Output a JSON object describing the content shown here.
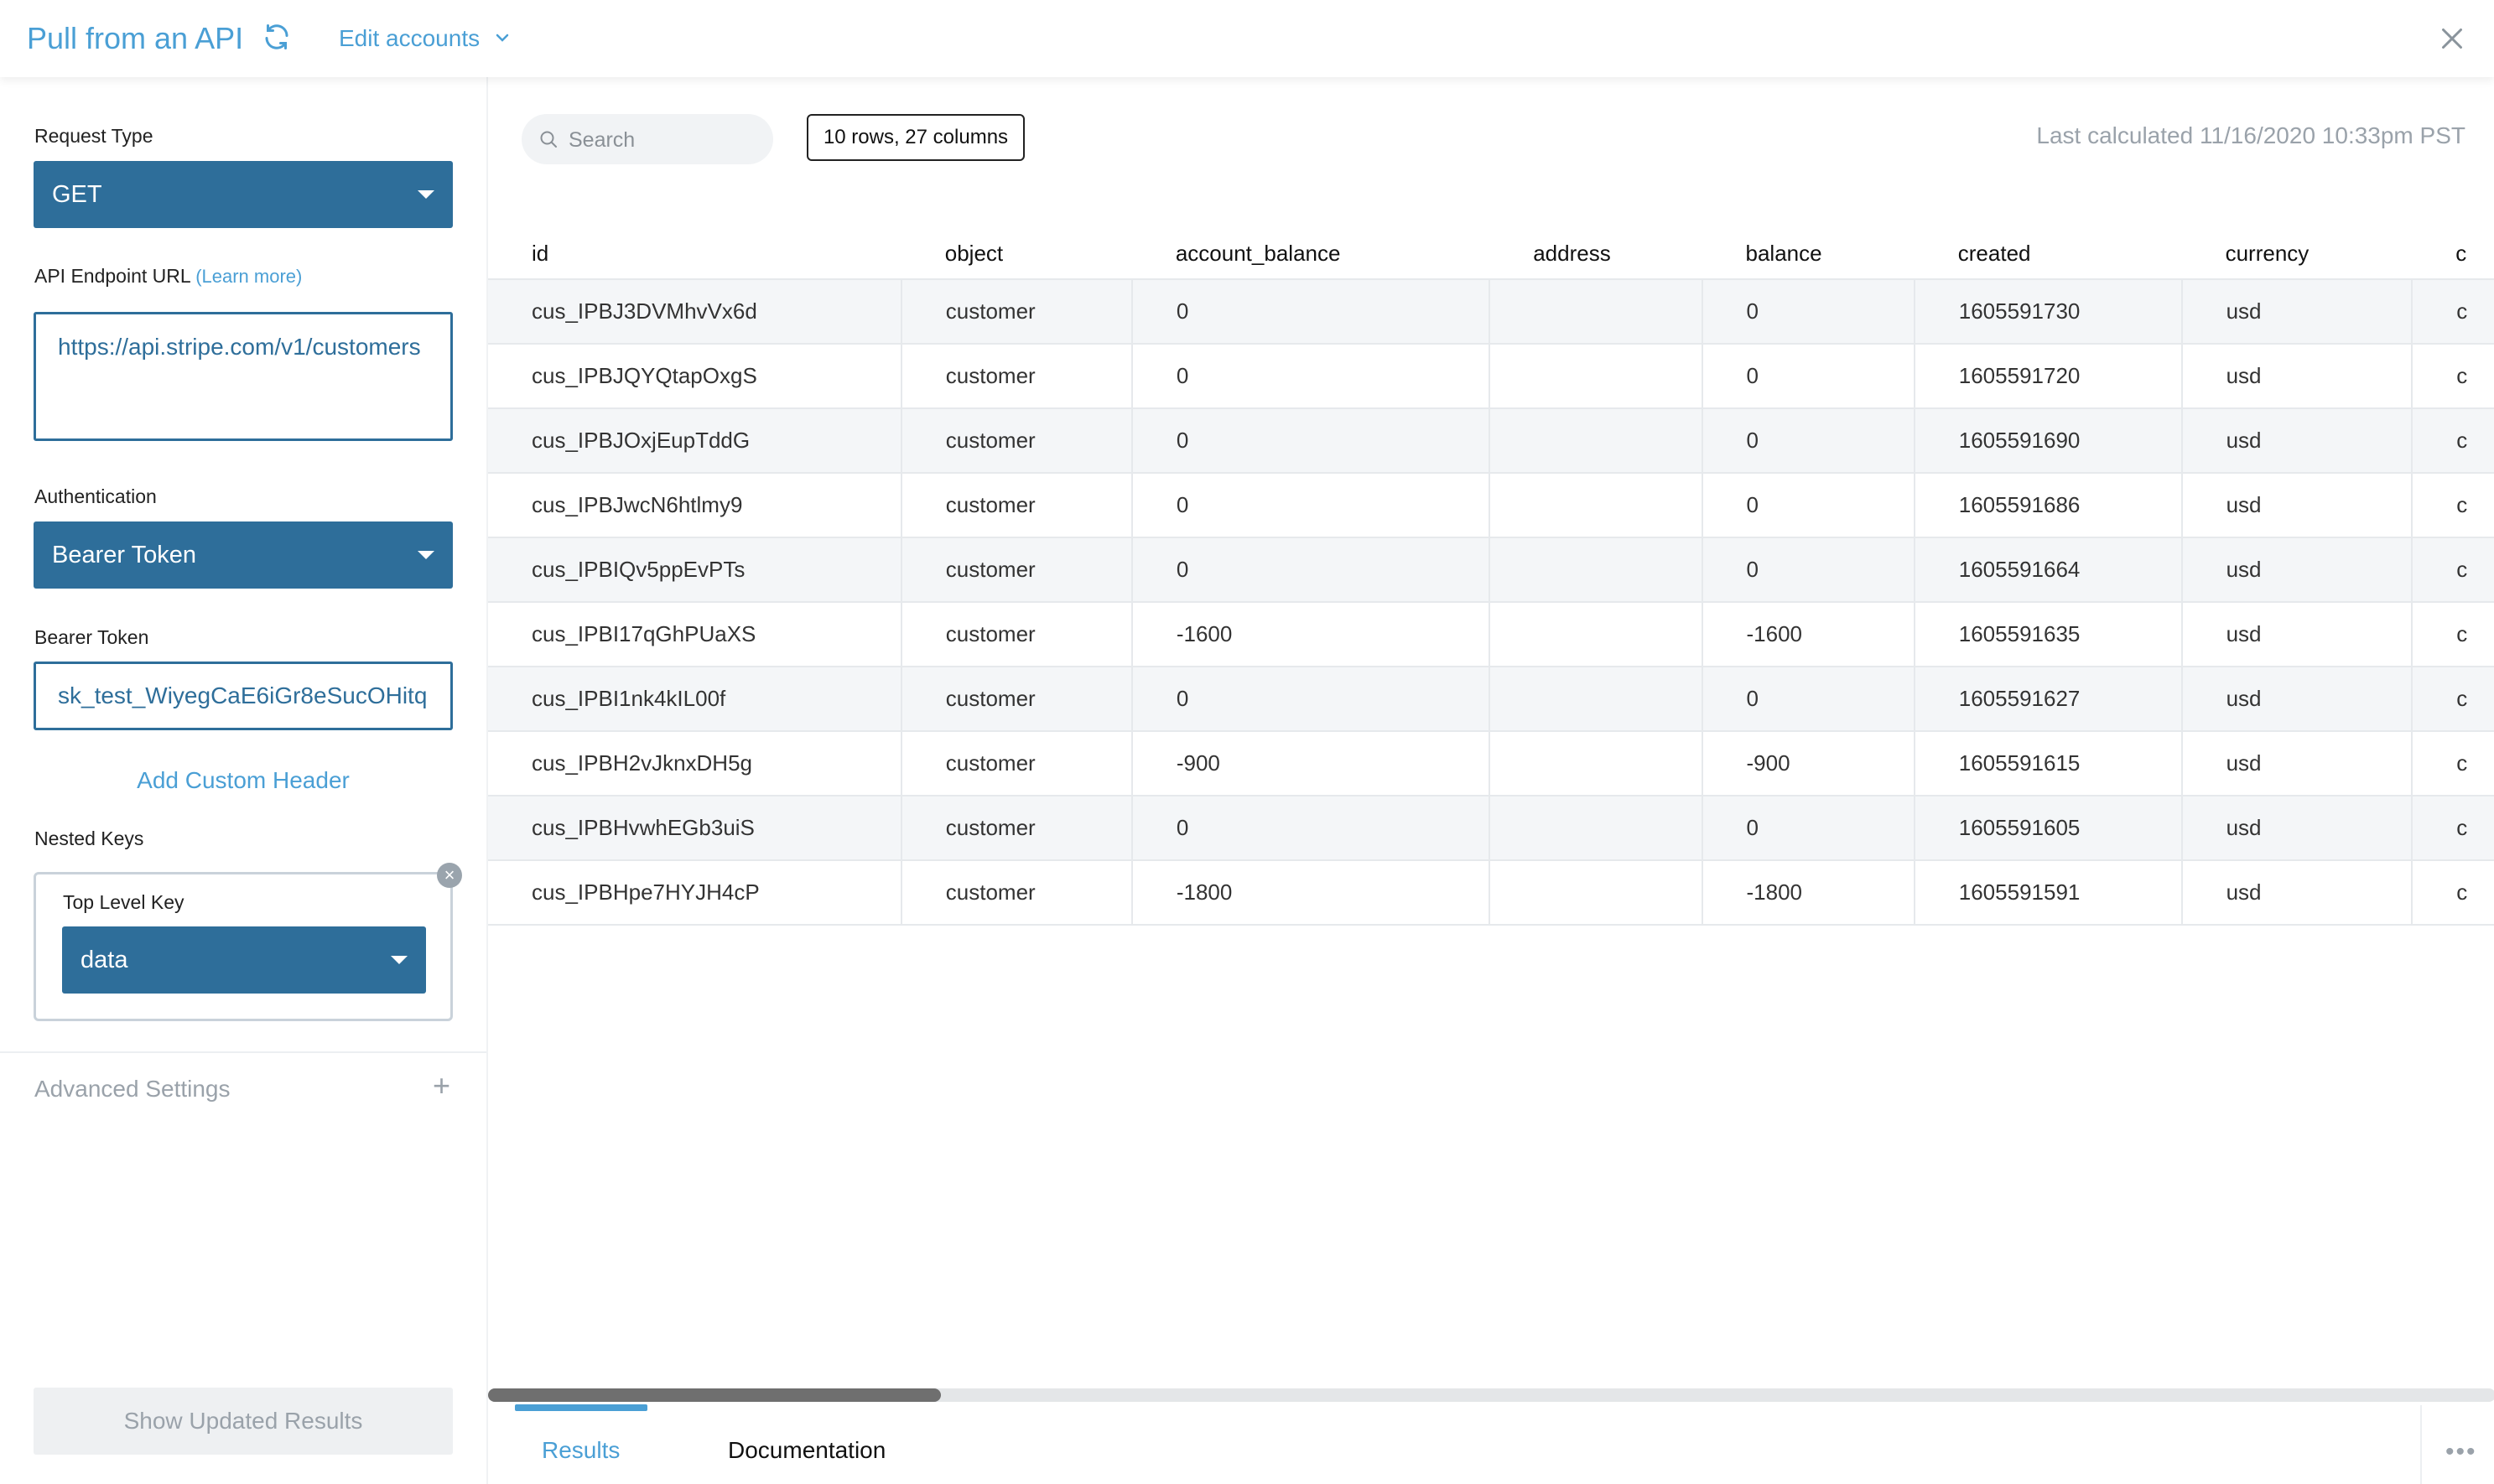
{
  "header": {
    "title": "Pull from an API",
    "edit_accounts": "Edit accounts"
  },
  "left": {
    "request_type_label": "Request Type",
    "request_type_value": "GET",
    "endpoint_label": "API Endpoint URL",
    "learn_more": "(Learn more)",
    "endpoint_value": "https://api.stripe.com/v1/customers",
    "auth_label": "Authentication",
    "auth_value": "Bearer Token",
    "token_label": "Bearer Token",
    "token_value": "sk_test_WiyegCaE6iGr8eSucOHitq",
    "add_header": "Add Custom Header",
    "nested_label": "Nested Keys",
    "top_level_label": "Top Level Key",
    "top_level_value": "data",
    "advanced": "Advanced Settings",
    "show_updated": "Show Updated Results"
  },
  "right": {
    "search_placeholder": "Search",
    "rows_badge": "10 rows, 27 columns",
    "last_calculated": "Last calculated 11/16/2020 10:33pm PST",
    "columns": [
      "id",
      "object",
      "account_balance",
      "address",
      "balance",
      "created",
      "currency",
      "c"
    ],
    "rows": [
      [
        "cus_IPBJ3DVMhvVx6d",
        "customer",
        "0",
        "",
        "0",
        "1605591730",
        "usd",
        "c"
      ],
      [
        "cus_IPBJQYQtapOxgS",
        "customer",
        "0",
        "",
        "0",
        "1605591720",
        "usd",
        "c"
      ],
      [
        "cus_IPBJOxjEupTddG",
        "customer",
        "0",
        "",
        "0",
        "1605591690",
        "usd",
        "c"
      ],
      [
        "cus_IPBJwcN6htlmy9",
        "customer",
        "0",
        "",
        "0",
        "1605591686",
        "usd",
        "c"
      ],
      [
        "cus_IPBIQv5ppEvPTs",
        "customer",
        "0",
        "",
        "0",
        "1605591664",
        "usd",
        "c"
      ],
      [
        "cus_IPBI17qGhPUaXS",
        "customer",
        "-1600",
        "",
        "-1600",
        "1605591635",
        "usd",
        "c"
      ],
      [
        "cus_IPBI1nk4kIL00f",
        "customer",
        "0",
        "",
        "0",
        "1605591627",
        "usd",
        "c"
      ],
      [
        "cus_IPBH2vJknxDH5g",
        "customer",
        "-900",
        "",
        "-900",
        "1605591615",
        "usd",
        "c"
      ],
      [
        "cus_IPBHvwhEGb3uiS",
        "customer",
        "0",
        "",
        "0",
        "1605591605",
        "usd",
        "c"
      ],
      [
        "cus_IPBHpe7HYJH4cP",
        "customer",
        "-1800",
        "",
        "-1800",
        "1605591591",
        "usd",
        "c"
      ]
    ],
    "tabs": {
      "results": "Results",
      "documentation": "Documentation"
    },
    "more": "•••"
  },
  "colors": {
    "accent": "#4a9fd5",
    "select_bg": "#2e6e9a"
  }
}
